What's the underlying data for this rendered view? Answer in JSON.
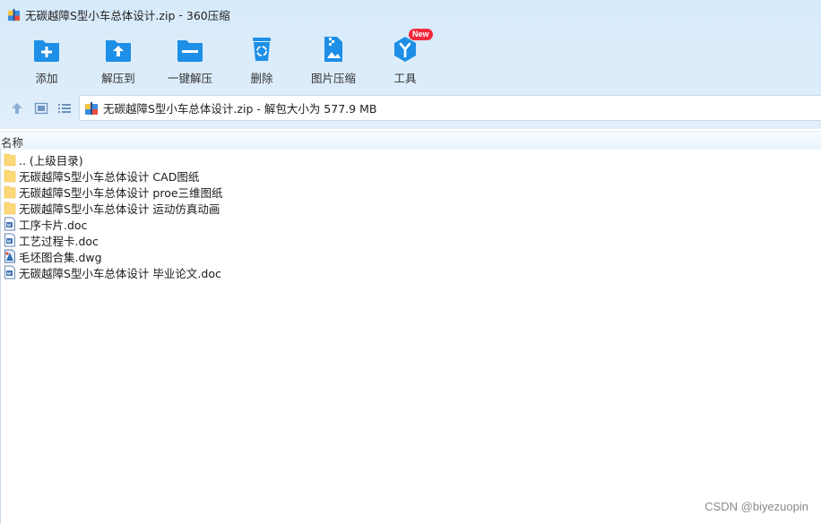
{
  "window": {
    "title_file": "无碳越障S型小车总体设计.zip",
    "title_sep": "-",
    "app_name": "360压缩"
  },
  "toolbar": {
    "buttons": [
      {
        "id": "add",
        "label": "添加",
        "icon": "folder-add-icon"
      },
      {
        "id": "extract",
        "label": "解压到",
        "icon": "folder-extract-icon"
      },
      {
        "id": "quick_extract",
        "label": "一键解压",
        "icon": "folder-quick-extract-icon"
      },
      {
        "id": "delete",
        "label": "删除",
        "icon": "trash-icon"
      },
      {
        "id": "image_compress",
        "label": "图片压缩",
        "icon": "image-compress-icon"
      },
      {
        "id": "tools",
        "label": "工具",
        "icon": "tools-icon",
        "badge": "New"
      }
    ]
  },
  "navbar": {
    "icons": [
      "up-arrow-icon",
      "view-thumbnail-icon",
      "view-list-icon"
    ],
    "path": "无碳越障S型小车总体设计.zip - 解包大小为 577.9 MB"
  },
  "columns": {
    "name": "名称"
  },
  "files": [
    {
      "name": ".. (上级目录)",
      "type": "folder"
    },
    {
      "name": "无碳越障S型小车总体设计 CAD图纸",
      "type": "folder"
    },
    {
      "name": "无碳越障S型小车总体设计 proe三维图纸",
      "type": "folder"
    },
    {
      "name": "无碳越障S型小车总体设计 运动仿真动画",
      "type": "folder"
    },
    {
      "name": "工序卡片.doc",
      "type": "doc"
    },
    {
      "name": "工艺过程卡.doc",
      "type": "doc"
    },
    {
      "name": "毛坯图合集.dwg",
      "type": "dwg"
    },
    {
      "name": "无碳越障S型小车总体设计 毕业论文.doc",
      "type": "doc"
    }
  ],
  "watermark": "CSDN @biyezuopin",
  "colors": {
    "toolbar_blue": "#1e8fe6",
    "band_bg": "#dcecfa",
    "badge_red": "#f1293c",
    "folder_yellow": "#ffd877"
  }
}
